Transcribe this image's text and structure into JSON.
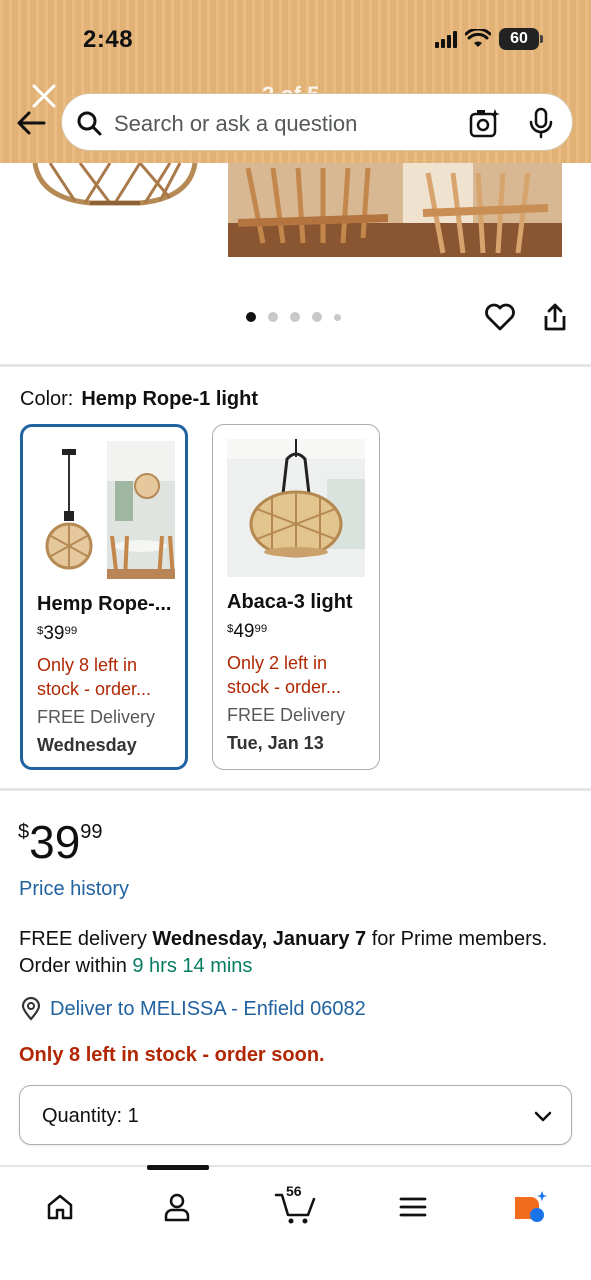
{
  "status_bar": {
    "time": "2:48",
    "battery": "60"
  },
  "header": {
    "image_counter": "2 of 5",
    "search_placeholder": "Search or ask a question"
  },
  "carousel": {
    "total_images": 5,
    "active_index": 1
  },
  "color": {
    "label": "Color:",
    "selected_value": "Hemp Rope-1 light"
  },
  "variants": [
    {
      "name": "Hemp Rope-...",
      "price_currency": "$",
      "price_dollars": "39",
      "price_cents": "99",
      "stock_line1": "Only 8 left in",
      "stock_line2": "stock - order...",
      "delivery": "FREE Delivery",
      "date": "Wednesday",
      "selected": true
    },
    {
      "name": "Abaca-3 light",
      "price_currency": "$",
      "price_dollars": "49",
      "price_cents": "99",
      "stock_line1": "Only 2 left in",
      "stock_line2": "stock - order...",
      "delivery": "FREE Delivery",
      "date": "Tue, Jan 13",
      "selected": false
    }
  ],
  "buybox": {
    "price_currency": "$",
    "price_dollars": "39",
    "price_cents": "99",
    "price_history": "Price history",
    "delivery_prefix": "FREE delivery ",
    "delivery_date": "Wednesday, January 7",
    "delivery_suffix": " for Prime members.",
    "order_within_prefix": "Order within ",
    "order_within_time": "9 hrs 14 mins",
    "deliver_to": "Deliver to MELISSA - Enfield 06082",
    "stock_warning": "Only 8 left in stock - order soon.",
    "quantity_label": "Quantity: 1"
  },
  "bottom_nav": {
    "cart_count": "56"
  },
  "colors": {
    "link": "#2162a1",
    "warning": "#b12704",
    "green": "#067d62",
    "header_bg": "#e8b77a",
    "selected_border": "#2162a1"
  }
}
